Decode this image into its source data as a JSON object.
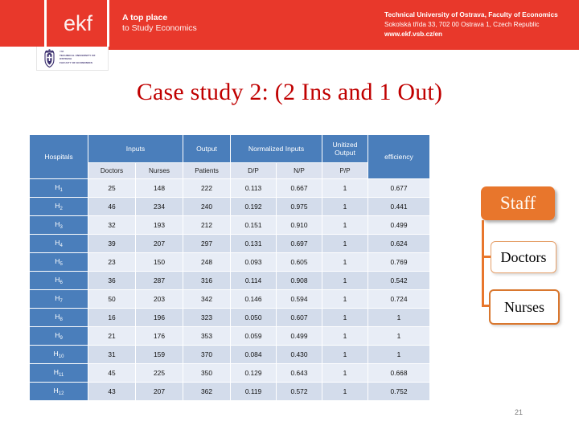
{
  "header": {
    "logo_text": "ekf",
    "tagline_line1": "A top place",
    "tagline_line2": "to Study Economics",
    "university_line1": "Technical University of Ostrava, Faculty of Economics",
    "university_line2": "Sokolská třída 33, 702 00 Ostrava 1, Czech Republic",
    "university_line3": "www.ekf.vsb.cz/en",
    "crest_line1": "TECHNICAL UNIVERSITY OF OSTRAVA",
    "crest_line2": "FACULTY OF ECONOMICS",
    "crest_tiny": "VSB",
    "band_color": "#E8382B"
  },
  "slide": {
    "title": "Case study 2: (2 Ins and 1 Out)",
    "title_color": "#C00000",
    "page_number": "21"
  },
  "table": {
    "group_headers": {
      "hospitals": "Hospitals",
      "inputs": "Inputs",
      "output": "Output",
      "normalized_inputs": "Normalized Inputs",
      "unitized_output": "Unitized Output",
      "efficiency": "efficiency"
    },
    "sub_headers": [
      "Doctors",
      "Nurses",
      "Patients",
      "D/P",
      "N/P",
      "P/P"
    ],
    "header_bg": "#4A7EBB",
    "subheader_bg": "#DCE2EF",
    "row_bg_odd": "#E8EDF6",
    "row_bg_even": "#D3DCEB",
    "rows": [
      {
        "hospital": "H",
        "index": "1",
        "doctors": "25",
        "nurses": "148",
        "patients": "222",
        "dp": "0.113",
        "np": "0.667",
        "pp": "1",
        "efficiency": "0.677"
      },
      {
        "hospital": "H",
        "index": "2",
        "doctors": "46",
        "nurses": "234",
        "patients": "240",
        "dp": "0.192",
        "np": "0.975",
        "pp": "1",
        "efficiency": "0.441"
      },
      {
        "hospital": "H",
        "index": "3",
        "doctors": "32",
        "nurses": "193",
        "patients": "212",
        "dp": "0.151",
        "np": "0.910",
        "pp": "1",
        "efficiency": "0.499"
      },
      {
        "hospital": "H",
        "index": "4",
        "doctors": "39",
        "nurses": "207",
        "patients": "297",
        "dp": "0.131",
        "np": "0.697",
        "pp": "1",
        "efficiency": "0.624"
      },
      {
        "hospital": "H",
        "index": "5",
        "doctors": "23",
        "nurses": "150",
        "patients": "248",
        "dp": "0.093",
        "np": "0.605",
        "pp": "1",
        "efficiency": "0.769"
      },
      {
        "hospital": "H",
        "index": "6",
        "doctors": "36",
        "nurses": "287",
        "patients": "316",
        "dp": "0.114",
        "np": "0.908",
        "pp": "1",
        "efficiency": "0.542"
      },
      {
        "hospital": "H",
        "index": "7",
        "doctors": "50",
        "nurses": "203",
        "patients": "342",
        "dp": "0.146",
        "np": "0.594",
        "pp": "1",
        "efficiency": "0.724"
      },
      {
        "hospital": "H",
        "index": "8",
        "doctors": "16",
        "nurses": "196",
        "patients": "323",
        "dp": "0.050",
        "np": "0.607",
        "pp": "1",
        "efficiency": "1"
      },
      {
        "hospital": "H",
        "index": "9",
        "doctors": "21",
        "nurses": "176",
        "patients": "353",
        "dp": "0.059",
        "np": "0.499",
        "pp": "1",
        "efficiency": "1"
      },
      {
        "hospital": "H",
        "index": "10",
        "doctors": "31",
        "nurses": "159",
        "patients": "370",
        "dp": "0.084",
        "np": "0.430",
        "pp": "1",
        "efficiency": "1"
      },
      {
        "hospital": "H",
        "index": "11",
        "doctors": "45",
        "nurses": "225",
        "patients": "350",
        "dp": "0.129",
        "np": "0.643",
        "pp": "1",
        "efficiency": "0.668"
      },
      {
        "hospital": "H",
        "index": "12",
        "doctors": "43",
        "nurses": "207",
        "patients": "362",
        "dp": "0.119",
        "np": "0.572",
        "pp": "1",
        "efficiency": "0.752"
      }
    ]
  },
  "callout": {
    "root_label": "Staff",
    "root_color": "#E8762C",
    "children": [
      {
        "label": "Doctors",
        "border_color": "#E6A06A"
      },
      {
        "label": "Nurses",
        "border_color": "#D9772E"
      }
    ]
  }
}
